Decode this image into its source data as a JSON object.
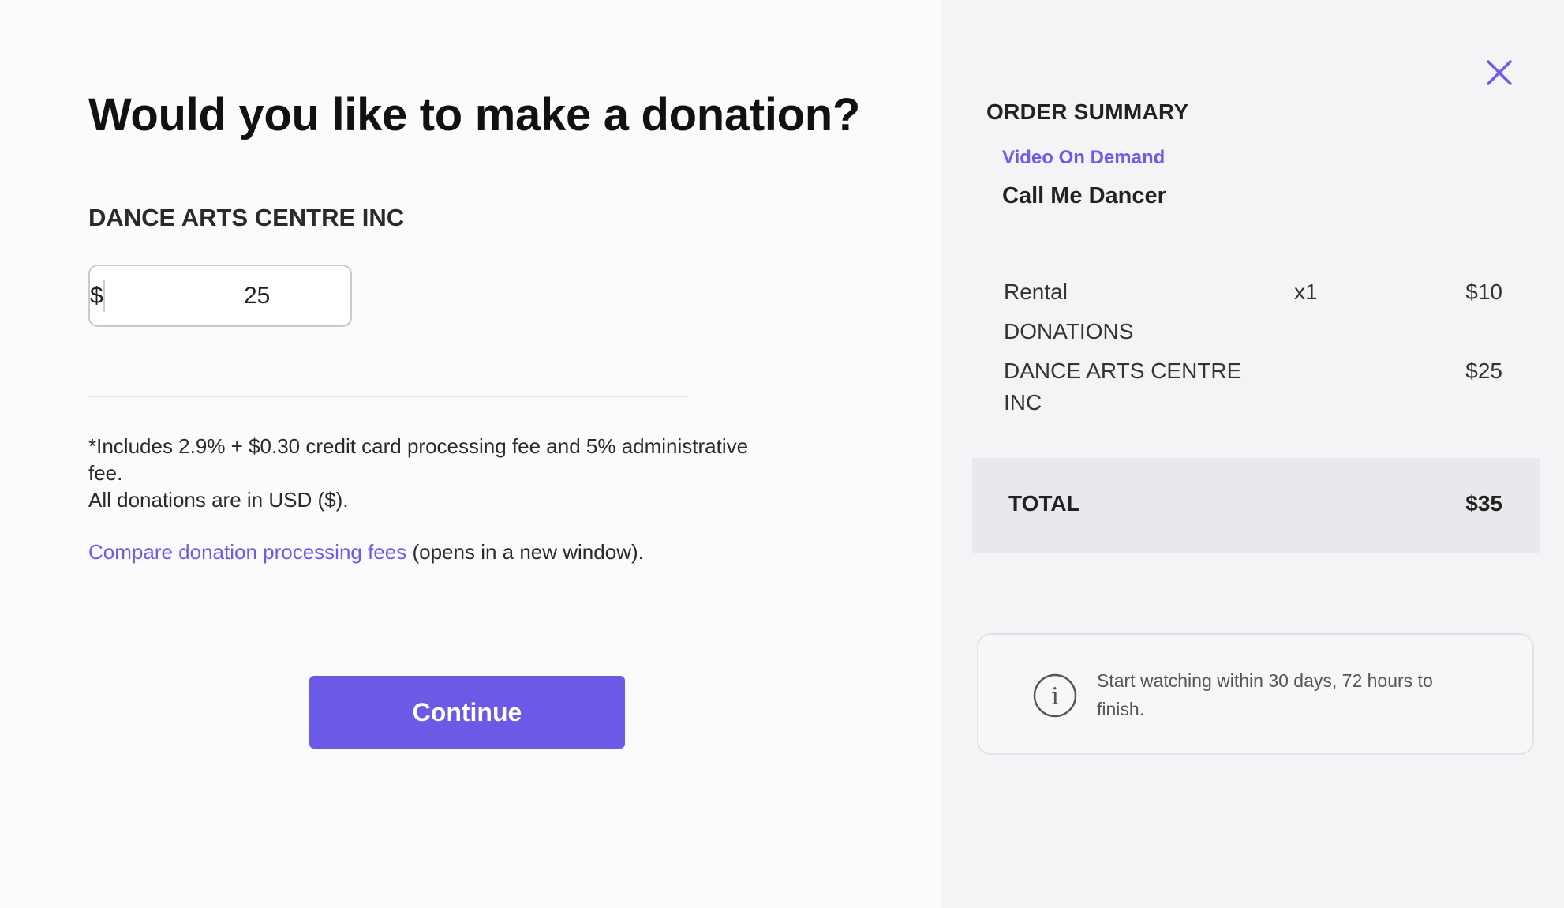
{
  "donation": {
    "heading": "Would you like to make a donation?",
    "organization": "DANCE ARTS CENTRE INC",
    "currency_symbol": "$",
    "amount": "25",
    "fee_note_line1": "*Includes 2.9% + $0.30 credit card processing fee and 5% administrative fee.",
    "fee_note_line2": "All donations are in USD ($).",
    "compare_link": "Compare donation processing fees",
    "compare_suffix": " (opens in a new window).",
    "continue_label": "Continue"
  },
  "summary": {
    "title": "ORDER SUMMARY",
    "product_type": "Video On Demand",
    "product_name": "Call Me Dancer",
    "rental": {
      "label": "Rental",
      "qty": "x1",
      "price": "$10"
    },
    "donations_header": "DONATIONS",
    "donation_item": {
      "label": "DANCE ARTS CENTRE INC",
      "price": "$25"
    },
    "total_label": "TOTAL",
    "total_value": "$35",
    "info_text": "Start watching within 30 days, 72 hours to finish."
  },
  "colors": {
    "accent": "#6a5ae6",
    "link": "#6c5ce7",
    "right_panel_bg": "#f4f3f6",
    "total_bg": "#e9e8ec"
  },
  "icons": {
    "close": "close-icon",
    "info": "info-icon"
  }
}
